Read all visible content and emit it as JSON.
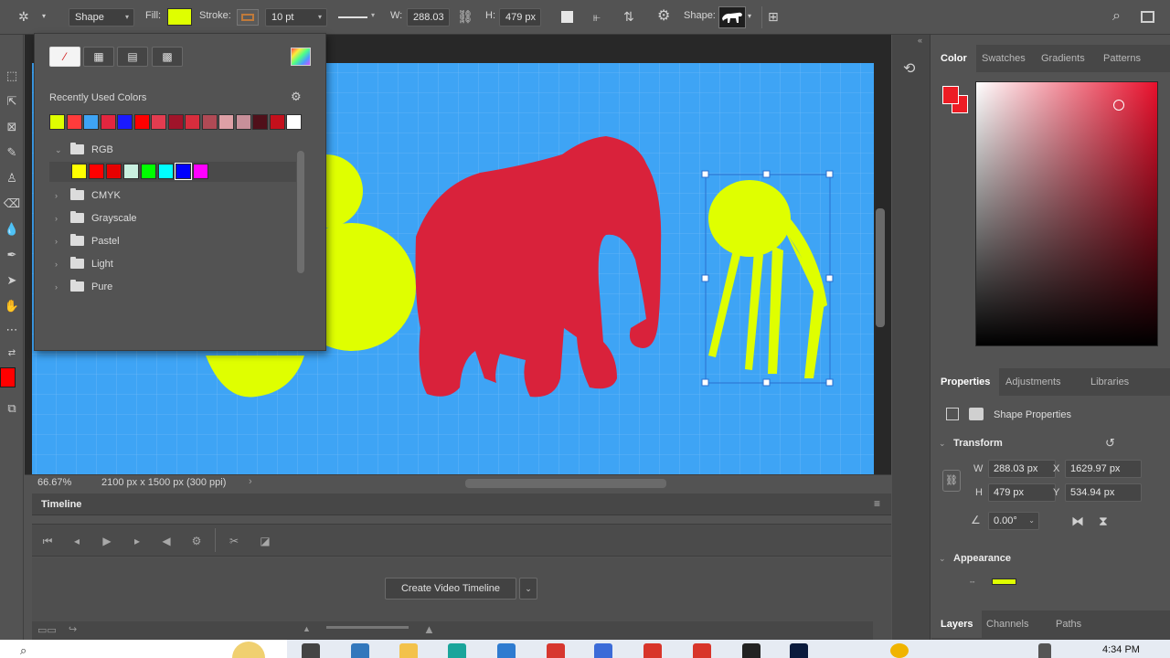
{
  "app": {
    "accent": "#3ea4f5",
    "document_bg": "#3ea4f5",
    "foreground_color": "#ff0000",
    "elephant_color": "#d9223b",
    "plant_color": "#dfff00"
  },
  "optionsbar": {
    "shape_mode": "Shape",
    "fill_label": "Fill:",
    "fill_color": "#dfff00",
    "stroke_label": "Stroke:",
    "stroke_width": "10 pt",
    "w_label": "W:",
    "w_value": "288.03",
    "h_label": "H:",
    "h_value": "479 px",
    "shape_label": "Shape:"
  },
  "swatches_popup": {
    "recent_title": "Recently Used Colors",
    "recent_colors": [
      "#dfff00",
      "#ff3b3b",
      "#3ea4f5",
      "#e3263f",
      "#1a1aff",
      "#ff0000",
      "#e33c50",
      "#a0142a",
      "#d82d3d",
      "#b04a55",
      "#dea0a6",
      "#c8909a",
      "#50101a",
      "#c4101c",
      "#ffffff"
    ],
    "folders": [
      {
        "name": "RGB",
        "expanded": true
      },
      {
        "name": "CMYK",
        "expanded": false
      },
      {
        "name": "Grayscale",
        "expanded": false
      },
      {
        "name": "Pastel",
        "expanded": false
      },
      {
        "name": "Light",
        "expanded": false
      },
      {
        "name": "Pure",
        "expanded": false
      }
    ],
    "rgb_colors": [
      "#ffff00",
      "#ff0000",
      "#e60000",
      "#c9f0e0",
      "#00ff00",
      "#00ffff",
      "#0000ff",
      "#ff00ff"
    ]
  },
  "status": {
    "zoom": "66.67%",
    "doc_size": "2100 px x 1500 px (300 ppi)"
  },
  "timeline": {
    "title": "Timeline",
    "create_button": "Create Video Timeline"
  },
  "color_panel": {
    "tabs": [
      "Color",
      "Swatches",
      "Gradients",
      "Patterns"
    ],
    "active_tab": "Color",
    "hue_color": "#e8102c"
  },
  "properties_panel": {
    "tabs": [
      "Properties",
      "Adjustments",
      "Libraries"
    ],
    "active_tab": "Properties",
    "subtitle": "Shape Properties",
    "transform_title": "Transform",
    "w_label": "W",
    "w_value": "288.03 px",
    "x_label": "X",
    "x_value": "1629.97 px",
    "h_label": "H",
    "h_value": "479 px",
    "y_label": "Y",
    "y_value": "534.94 px",
    "angle_value": "0.00°",
    "appearance_title": "Appearance",
    "appearance_color": "#dfff00"
  },
  "layers_panel": {
    "tabs": [
      "Layers",
      "Channels",
      "Paths"
    ],
    "active_tab": "Layers"
  },
  "taskbar": {
    "time": "4:34 PM"
  }
}
